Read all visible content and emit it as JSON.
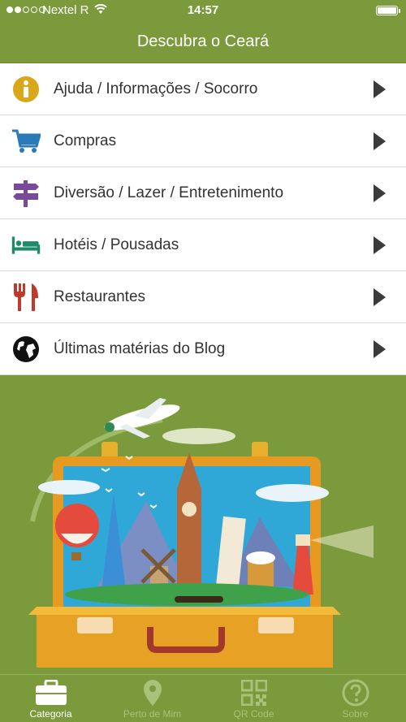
{
  "status": {
    "carrier": "Nextel R",
    "time": "14:57"
  },
  "header": {
    "title": "Descubra o Ceará"
  },
  "menu": [
    {
      "label": "Ajuda / Informações / Socorro",
      "icon": "info-icon"
    },
    {
      "label": "Compras",
      "icon": "shopping-cart-icon"
    },
    {
      "label": "Diversão / Lazer / Entretenimento",
      "icon": "signpost-icon"
    },
    {
      "label": "Hotéis / Pousadas",
      "icon": "bed-icon"
    },
    {
      "label": "Restaurantes",
      "icon": "fork-knife-icon"
    },
    {
      "label": "Últimas matérias do Blog",
      "icon": "globe-icon"
    }
  ],
  "tabs": [
    {
      "label": "Categoria",
      "icon": "briefcase-icon",
      "active": true
    },
    {
      "label": "Perto de Mim",
      "icon": "location-pin-icon",
      "active": false
    },
    {
      "label": "QR Code",
      "icon": "qr-code-icon",
      "active": false
    },
    {
      "label": "Sobre",
      "icon": "question-icon",
      "active": false
    }
  ],
  "colors": {
    "header_bg": "#7b9a3c",
    "tab_active": "#ffffff",
    "tab_inactive": "#a8c27a"
  }
}
